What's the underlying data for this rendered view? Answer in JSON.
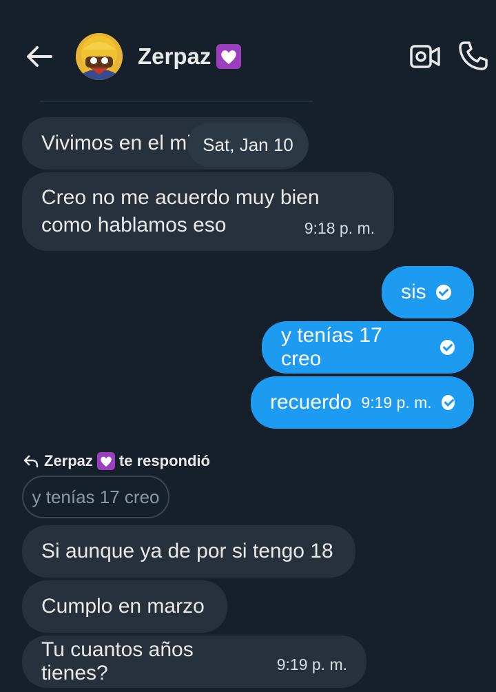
{
  "header": {
    "contact_name": "Zerpaz",
    "heart_emoji": "💟"
  },
  "date_separator": "Sat, Jan 10",
  "messages": [
    {
      "text": "Vivimos en el mis",
      "time": ""
    },
    {
      "text_line1": "Creo no me acuerdo muy bien",
      "text_line2": "como hablamos eso",
      "time": "9:18 p. m."
    },
    {
      "text": "sis",
      "time": ""
    },
    {
      "text": "y tenías 17 creo",
      "time": ""
    },
    {
      "text": "recuerdo",
      "time": "9:19 p. m."
    },
    {
      "text": "Si aunque ya de por si tengo 18",
      "time": ""
    },
    {
      "text": "Cumplo en marzo",
      "time": ""
    },
    {
      "text": "Tu cuantos años tienes?",
      "time": "9:19 p. m."
    }
  ],
  "reply": {
    "name": "Zerpaz",
    "suffix": "te respondió",
    "quoted_text": "y tenías 17 creo"
  },
  "icons": {
    "back": "arrow-left-icon",
    "video": "video-camera-icon",
    "phone": "phone-icon",
    "read": "check-circle-icon",
    "reply": "reply-arrow-icon"
  },
  "colors": {
    "background": "#16202b",
    "received_bubble": "#27313b",
    "sent_bubble": "#1d9bf0",
    "heart": "#9b3fbf"
  }
}
